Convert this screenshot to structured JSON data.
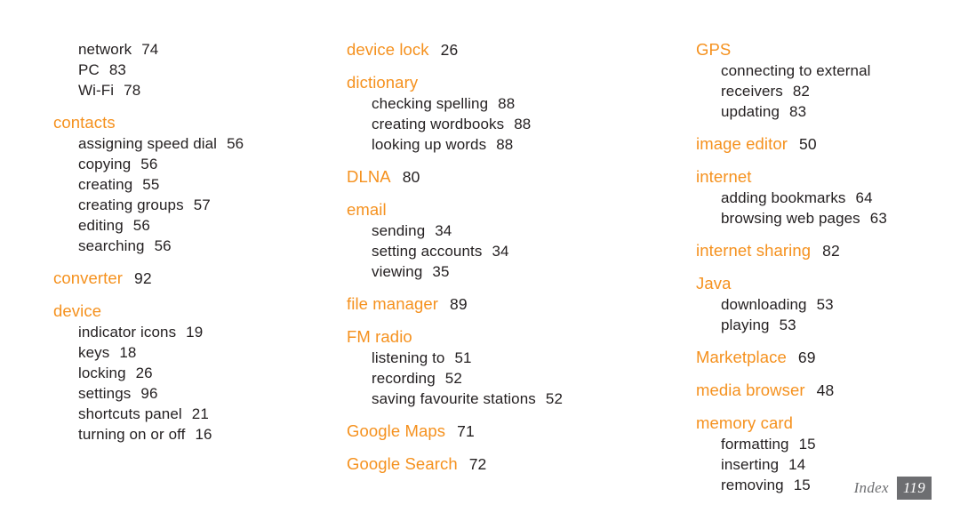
{
  "document": {
    "type": "index-page",
    "page_label": "Index",
    "page_number": "119",
    "accent_color": "#F5911E",
    "text_color": "#231F20",
    "footer_color": "#6D6E71"
  },
  "columns": [
    {
      "id": "column-1",
      "blocks": [
        {
          "kind": "continuation",
          "entries": [
            {
              "label": "network",
              "page": "74"
            },
            {
              "label": "PC",
              "page": "83"
            },
            {
              "label": "Wi-Fi",
              "page": "78"
            }
          ]
        },
        {
          "kind": "heading",
          "heading": "contacts",
          "heading_page": "",
          "entries": [
            {
              "label": "assigning speed dial",
              "page": "56"
            },
            {
              "label": "copying",
              "page": "56"
            },
            {
              "label": "creating",
              "page": "55"
            },
            {
              "label": "creating groups",
              "page": "57"
            },
            {
              "label": "editing",
              "page": "56"
            },
            {
              "label": "searching",
              "page": "56"
            }
          ]
        },
        {
          "kind": "heading",
          "heading": "converter",
          "heading_page": "92",
          "entries": []
        },
        {
          "kind": "heading",
          "heading": "device",
          "heading_page": "",
          "entries": [
            {
              "label": "indicator icons",
              "page": "19"
            },
            {
              "label": "keys",
              "page": "18"
            },
            {
              "label": "locking",
              "page": "26"
            },
            {
              "label": "settings",
              "page": "96"
            },
            {
              "label": "shortcuts panel",
              "page": "21"
            },
            {
              "label": "turning on or off",
              "page": "16"
            }
          ]
        }
      ]
    },
    {
      "id": "column-2",
      "blocks": [
        {
          "kind": "heading",
          "heading": "device lock",
          "heading_page": "26",
          "entries": []
        },
        {
          "kind": "heading",
          "heading": "dictionary",
          "heading_page": "",
          "entries": [
            {
              "label": "checking spelling",
              "page": "88"
            },
            {
              "label": "creating wordbooks",
              "page": "88"
            },
            {
              "label": "looking up words",
              "page": "88"
            }
          ]
        },
        {
          "kind": "heading",
          "heading": "DLNA",
          "heading_page": "80",
          "entries": []
        },
        {
          "kind": "heading",
          "heading": "email",
          "heading_page": "",
          "entries": [
            {
              "label": "sending",
              "page": "34"
            },
            {
              "label": "setting accounts",
              "page": "34"
            },
            {
              "label": "viewing",
              "page": "35"
            }
          ]
        },
        {
          "kind": "heading",
          "heading": "file manager",
          "heading_page": "89",
          "entries": []
        },
        {
          "kind": "heading",
          "heading": "FM radio",
          "heading_page": "",
          "entries": [
            {
              "label": "listening to",
              "page": "51"
            },
            {
              "label": "recording",
              "page": "52"
            },
            {
              "label": "saving favourite stations",
              "page": "52"
            }
          ]
        },
        {
          "kind": "heading",
          "heading": "Google Maps",
          "heading_page": "71",
          "entries": []
        },
        {
          "kind": "heading",
          "heading": "Google Search",
          "heading_page": "72",
          "entries": []
        }
      ]
    },
    {
      "id": "column-3",
      "blocks": [
        {
          "kind": "heading",
          "heading": "GPS",
          "heading_page": "",
          "entries": [
            {
              "label": "connecting to external",
              "page": "",
              "wrap_next": "receivers",
              "wrap_page": "82"
            },
            {
              "label": "updating",
              "page": "83"
            }
          ]
        },
        {
          "kind": "heading",
          "heading": "image editor",
          "heading_page": "50",
          "entries": []
        },
        {
          "kind": "heading",
          "heading": "internet",
          "heading_page": "",
          "entries": [
            {
              "label": "adding bookmarks",
              "page": "64"
            },
            {
              "label": "browsing web pages",
              "page": "63"
            }
          ]
        },
        {
          "kind": "heading",
          "heading": "internet sharing",
          "heading_page": "82",
          "entries": []
        },
        {
          "kind": "heading",
          "heading": "Java",
          "heading_page": "",
          "entries": [
            {
              "label": "downloading",
              "page": "53"
            },
            {
              "label": "playing",
              "page": "53"
            }
          ]
        },
        {
          "kind": "heading",
          "heading": "Marketplace",
          "heading_page": "69",
          "entries": []
        },
        {
          "kind": "heading",
          "heading": "media browser",
          "heading_page": "48",
          "entries": []
        },
        {
          "kind": "heading",
          "heading": "memory card",
          "heading_page": "",
          "entries": [
            {
              "label": "formatting",
              "page": "15"
            },
            {
              "label": "inserting",
              "page": "14"
            },
            {
              "label": "removing",
              "page": "15"
            }
          ]
        }
      ]
    }
  ]
}
